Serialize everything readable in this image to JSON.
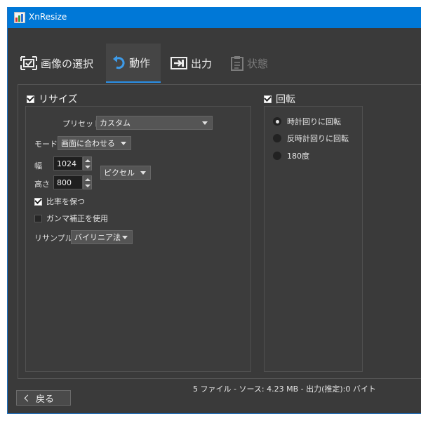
{
  "window": {
    "title": "XnResize"
  },
  "tabs": [
    {
      "label": "画像の選択",
      "icon": "select-image-icon"
    },
    {
      "label": "動作",
      "icon": "rotate-arrow-icon"
    },
    {
      "label": "出力",
      "icon": "output-icon"
    },
    {
      "label": "状態",
      "icon": "clipboard-icon"
    }
  ],
  "resize": {
    "title": "リサイズ",
    "enabled": true,
    "preset_label": "プリセット",
    "preset_value": "カスタム",
    "mode_label": "モード",
    "mode_value": "画面に合わせる",
    "width_label": "幅",
    "width_value": "1024",
    "height_label": "高さ",
    "height_value": "800",
    "unit_value": "ピクセル",
    "keep_ratio_label": "比率を保つ",
    "keep_ratio": true,
    "gamma_label": "ガンマ補正を使用",
    "gamma": false,
    "resample_label": "リサンプル",
    "resample_value": "バイリニア法"
  },
  "rotate": {
    "title": "回転",
    "enabled": true,
    "options": [
      "時計回りに回転",
      "反時計回りに回転",
      "180度"
    ],
    "selected_index": 0
  },
  "status_text": "5 ファイル - ソース: 4.23 MB - 出力(推定):0 バイト",
  "back_button": "戻る",
  "colors": {
    "titlebar": "#0078d7",
    "background": "#3a3a3a",
    "tab_accent": "#2a8ee6"
  }
}
